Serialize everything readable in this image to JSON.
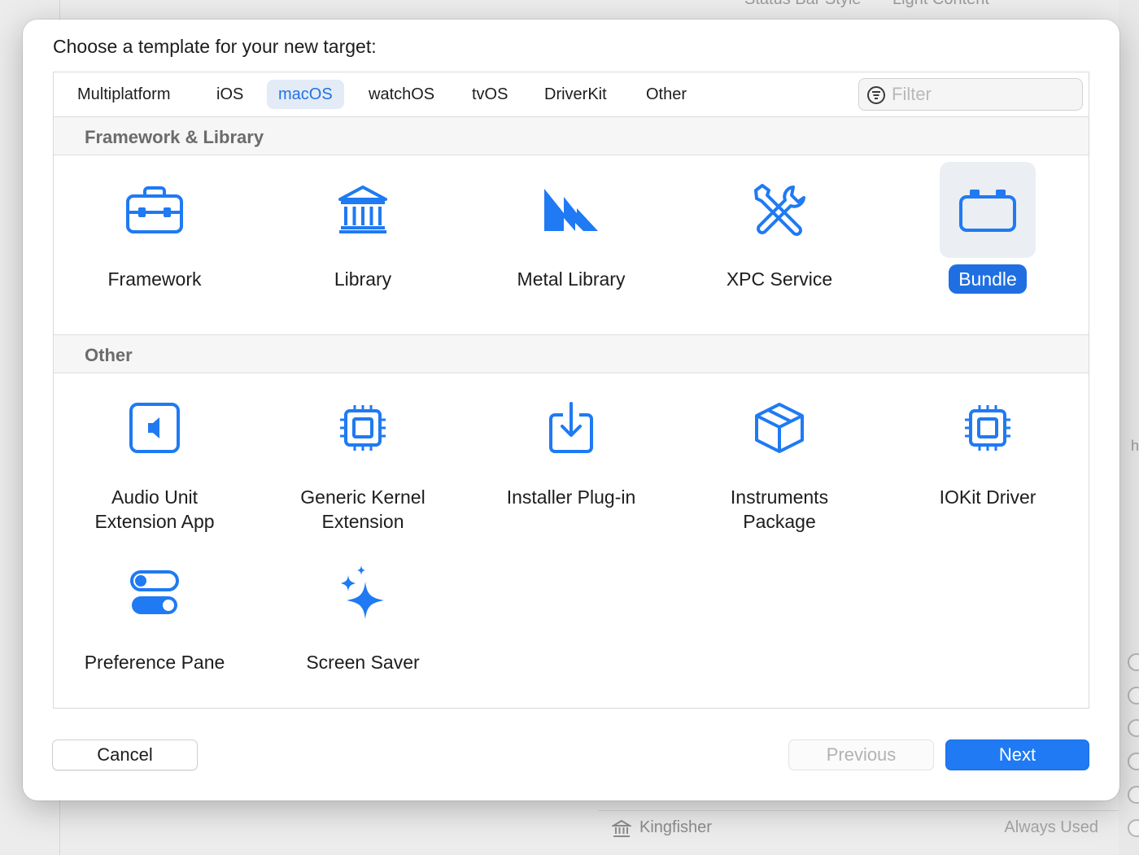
{
  "background": {
    "top_text_left": "Status Bar Style",
    "top_text_right": "Light Content",
    "right_edge_text": "h",
    "bottom_row": {
      "name": "Kingfisher",
      "status": "Always Used"
    }
  },
  "dialog": {
    "title": "Choose a template for your new target:",
    "tabs": [
      "Multiplatform",
      "iOS",
      "macOS",
      "watchOS",
      "tvOS",
      "DriverKit",
      "Other"
    ],
    "selected_tab": "macOS",
    "filter": {
      "placeholder": "Filter",
      "value": ""
    },
    "sections": [
      {
        "header": "Framework & Library",
        "items": [
          {
            "label": "Framework",
            "icon": "toolbox-icon"
          },
          {
            "label": "Library",
            "icon": "building-columns-icon"
          },
          {
            "label": "Metal Library",
            "icon": "metal-icon"
          },
          {
            "label": "XPC Service",
            "icon": "wrench-screwdriver-icon"
          },
          {
            "label": "Bundle",
            "icon": "bundle-icon",
            "selected": true
          }
        ]
      },
      {
        "header": "Other",
        "items": [
          {
            "label": "Audio Unit\nExtension App",
            "icon": "speaker-square-icon"
          },
          {
            "label": "Generic Kernel\nExtension",
            "icon": "cpu-icon"
          },
          {
            "label": "Installer Plug-in",
            "icon": "tray-download-icon"
          },
          {
            "label": "Instruments\nPackage",
            "icon": "shipping-box-icon"
          },
          {
            "label": "IOKit Driver",
            "icon": "cpu-icon"
          },
          {
            "label": "Preference Pane",
            "icon": "switches-icon"
          },
          {
            "label": "Screen Saver",
            "icon": "sparkles-icon"
          }
        ]
      }
    ],
    "buttons": {
      "cancel": "Cancel",
      "previous": "Previous",
      "next": "Next"
    }
  },
  "colors": {
    "accent": "#1f7af3",
    "icon_blue": "#1f7af3",
    "selected_tab_bg": "#e3ebf7"
  }
}
